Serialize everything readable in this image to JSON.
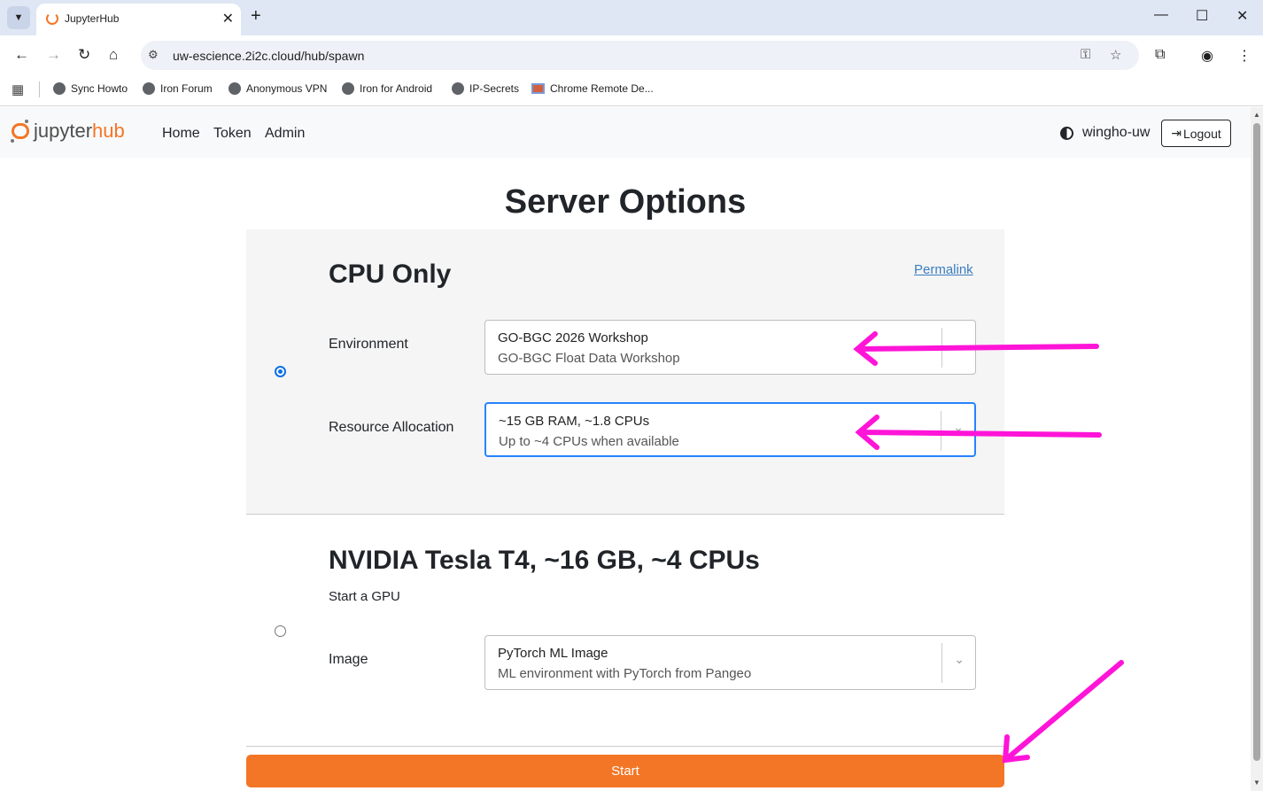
{
  "browser": {
    "tab_title": "JupyterHub",
    "url": "uw-escience.2i2c.cloud/hub/spawn",
    "bookmarks": [
      "Sync Howto",
      "Iron Forum",
      "Anonymous VPN",
      "Iron for Android",
      "IP-Secrets",
      "Chrome Remote De..."
    ]
  },
  "navbar": {
    "logo_a": "jupyter",
    "logo_b": "hub",
    "links": [
      "Home",
      "Token",
      "Admin"
    ],
    "username": "wingho-uw",
    "logout_label": "Logout"
  },
  "page_title": "Server Options",
  "options": {
    "cpu": {
      "title": "CPU Only",
      "permalink": "Permalink",
      "environment_label": "Environment",
      "environment_value": "GO-BGC 2026 Workshop",
      "environment_desc": "GO-BGC Float Data Workshop",
      "resource_label": "Resource Allocation",
      "resource_value": "~15 GB RAM, ~1.8 CPUs",
      "resource_desc": "Up to ~4 CPUs when available"
    },
    "gpu": {
      "title": "NVIDIA Tesla T4, ~16 GB, ~4 CPUs",
      "description": "Start a GPU",
      "image_label": "Image",
      "image_value": "PyTorch ML Image",
      "image_desc": "ML environment with PyTorch from Pangeo"
    }
  },
  "start_label": "Start",
  "colors": {
    "accent": "#f37626",
    "annotation": "#ff14d8",
    "radio": "#0b6fe8"
  }
}
